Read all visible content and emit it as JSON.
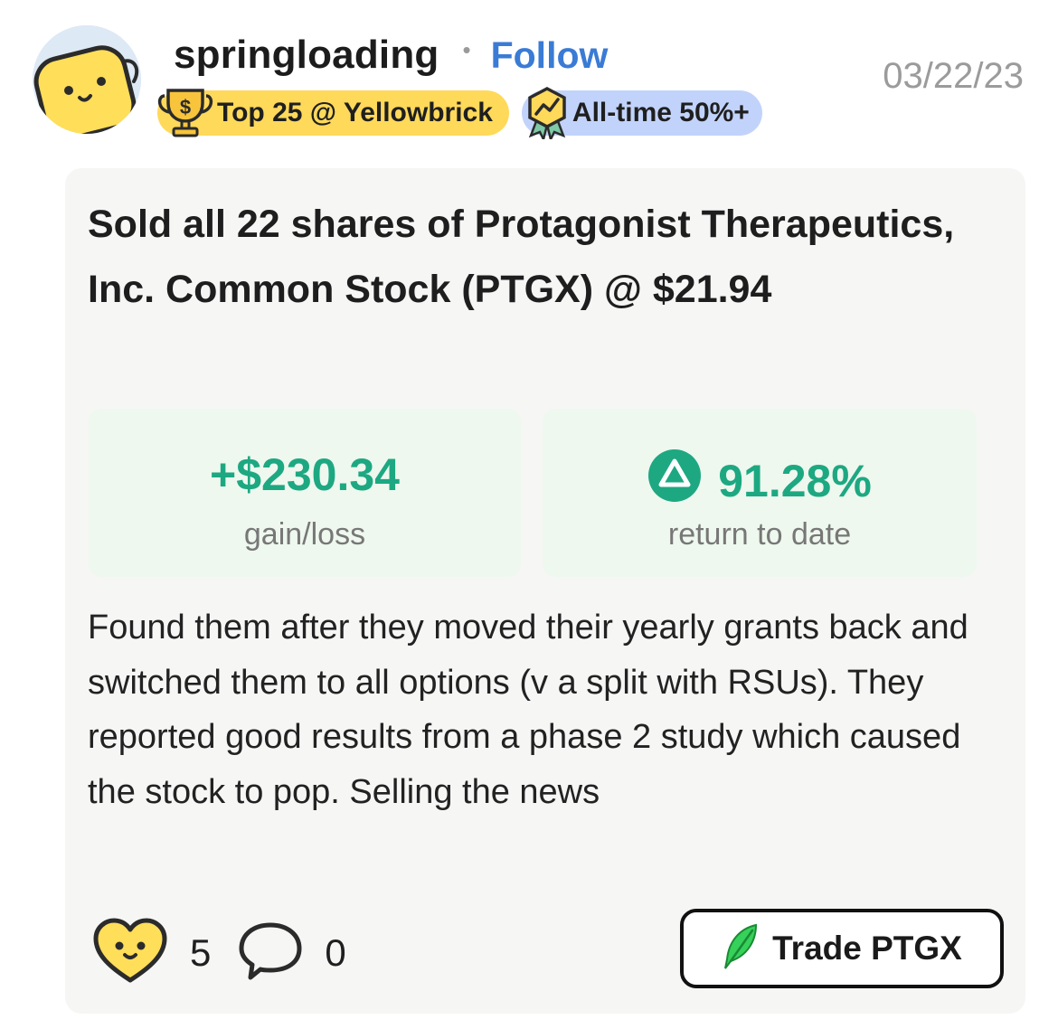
{
  "header": {
    "username": "springloading",
    "separator": "•",
    "follow_label": "Follow",
    "date": "03/22/23",
    "avatar_icon": "yellow-mascot-avatar",
    "badges": [
      {
        "label": "Top 25 @ Yellowbrick",
        "icon": "trophy-icon",
        "color": "#ffd95a"
      },
      {
        "label": "All-time 50%+",
        "icon": "trend-medal-icon",
        "color": "#c2d3fb"
      }
    ]
  },
  "post": {
    "title": "Sold all 22 shares of Protagonist Therapeutics, Inc. Common Stock (PTGX) @ $21.94",
    "stats": {
      "gain_value": "+$230.34",
      "gain_label": "gain/loss",
      "return_value": "91.28%",
      "return_label": "return to date",
      "accent_color": "#1da882"
    },
    "body": "Found them after they moved their yearly grants back and switched them to all options (v a split with RSUs). They reported good results from a phase 2 study which caused the stock to pop. Selling the news"
  },
  "footer": {
    "like_icon": "heart-face-icon",
    "like_count": "5",
    "comment_icon": "comment-bubble-icon",
    "comment_count": "0",
    "trade_icon": "robinhood-feather-icon",
    "trade_label": "Trade PTGX"
  }
}
